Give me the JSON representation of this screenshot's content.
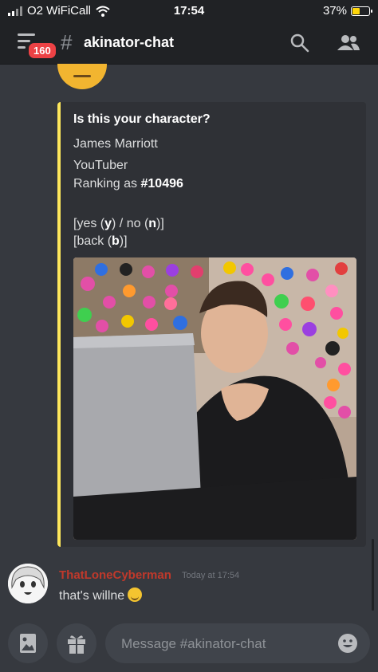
{
  "status_bar": {
    "carrier": "O2 WiFiCall",
    "time": "17:54",
    "battery": "37%",
    "battery_level": 0.37
  },
  "header": {
    "badge_count": "160",
    "hash": "#",
    "channel_name": "akinator-chat",
    "icons": [
      "menu-icon",
      "search-icon",
      "members-icon"
    ]
  },
  "embed": {
    "accent_color": "#fee75c",
    "title": "Is this your character?",
    "name": "James Marriott",
    "description": "YouTuber",
    "ranking_prefix": "Ranking as ",
    "ranking_value": "#10496",
    "answer_open": "[yes (",
    "yes_key": "y",
    "answer_mid": ") / no (",
    "no_key": "n",
    "answer_close": ")]",
    "back_open": "[back (",
    "back_key": "b",
    "back_close": ")]"
  },
  "message": {
    "username": "ThatLoneCyberman",
    "username_color": "#c0392b",
    "timestamp": "Today at 17:54",
    "text": "that's willne",
    "emoji": "rofl-emoji"
  },
  "composer": {
    "placeholder": "Message #akinator-chat",
    "icons": [
      "image-icon",
      "gift-icon",
      "emoji-icon"
    ]
  }
}
